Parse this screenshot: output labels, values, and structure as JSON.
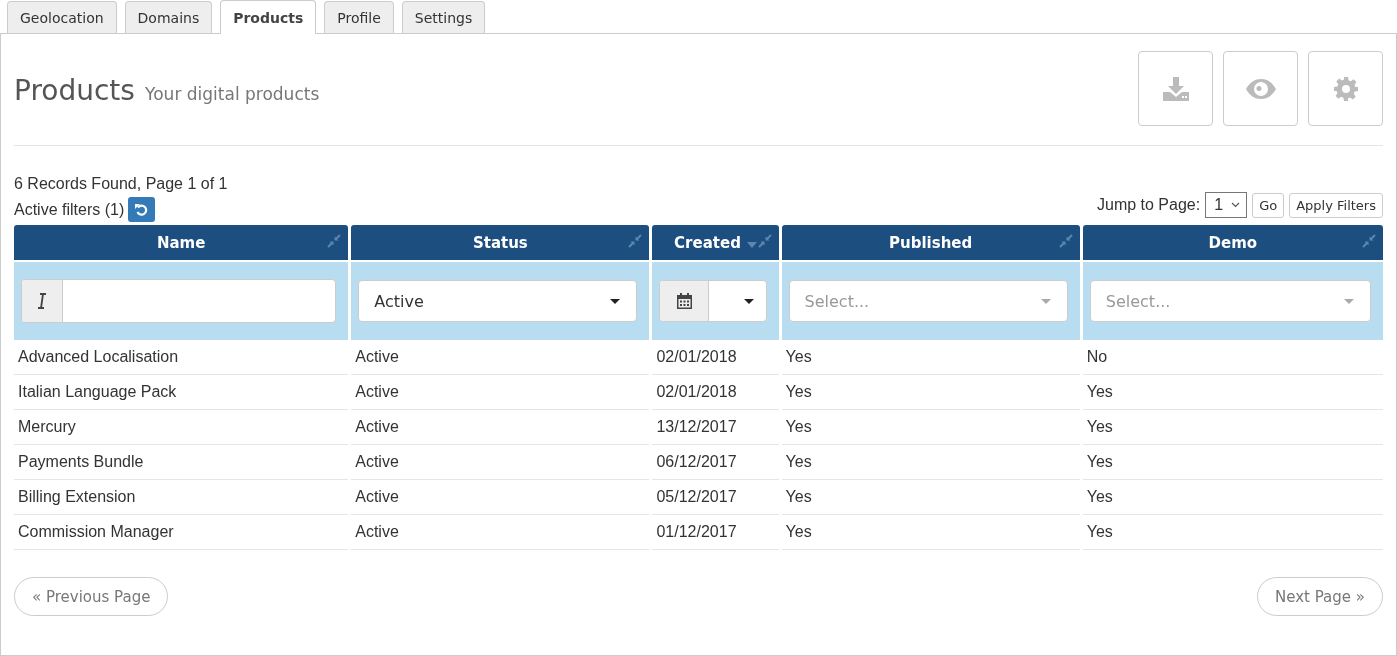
{
  "tabs": [
    {
      "label": "Geolocation",
      "selected": false
    },
    {
      "label": "Domains",
      "selected": false
    },
    {
      "label": "Products",
      "selected": true
    },
    {
      "label": "Profile",
      "selected": false
    },
    {
      "label": "Settings",
      "selected": false
    }
  ],
  "header": {
    "title": "Products",
    "subtitle": "Your digital products"
  },
  "records": "6 Records Found, Page 1 of 1",
  "active_filters": "Active filters (1)",
  "jump": {
    "label": "Jump to Page:",
    "value": "1",
    "go": "Go",
    "apply": "Apply Filters"
  },
  "columns": [
    {
      "label": "Name",
      "sorted": false,
      "filter": {
        "kind": "text"
      }
    },
    {
      "label": "Status",
      "sorted": false,
      "filter": {
        "kind": "select",
        "value": "Active"
      }
    },
    {
      "label": "Created",
      "sorted": true,
      "filter": {
        "kind": "date"
      }
    },
    {
      "label": "Published",
      "sorted": false,
      "filter": {
        "kind": "select",
        "placeholder": "Select..."
      }
    },
    {
      "label": "Demo",
      "sorted": false,
      "filter": {
        "kind": "select",
        "placeholder": "Select..."
      }
    }
  ],
  "rows": [
    [
      "Advanced Localisation",
      "Active",
      "02/01/2018",
      "Yes",
      "No"
    ],
    [
      "Italian Language Pack",
      "Active",
      "02/01/2018",
      "Yes",
      "Yes"
    ],
    [
      "Mercury",
      "Active",
      "13/12/2017",
      "Yes",
      "Yes"
    ],
    [
      "Payments Bundle",
      "Active",
      "06/12/2017",
      "Yes",
      "Yes"
    ],
    [
      "Billing Extension",
      "Active",
      "05/12/2017",
      "Yes",
      "Yes"
    ],
    [
      "Commission Manager",
      "Active",
      "01/12/2017",
      "Yes",
      "Yes"
    ]
  ],
  "pager": {
    "previous": "« Previous Page",
    "next": "Next Page »"
  }
}
